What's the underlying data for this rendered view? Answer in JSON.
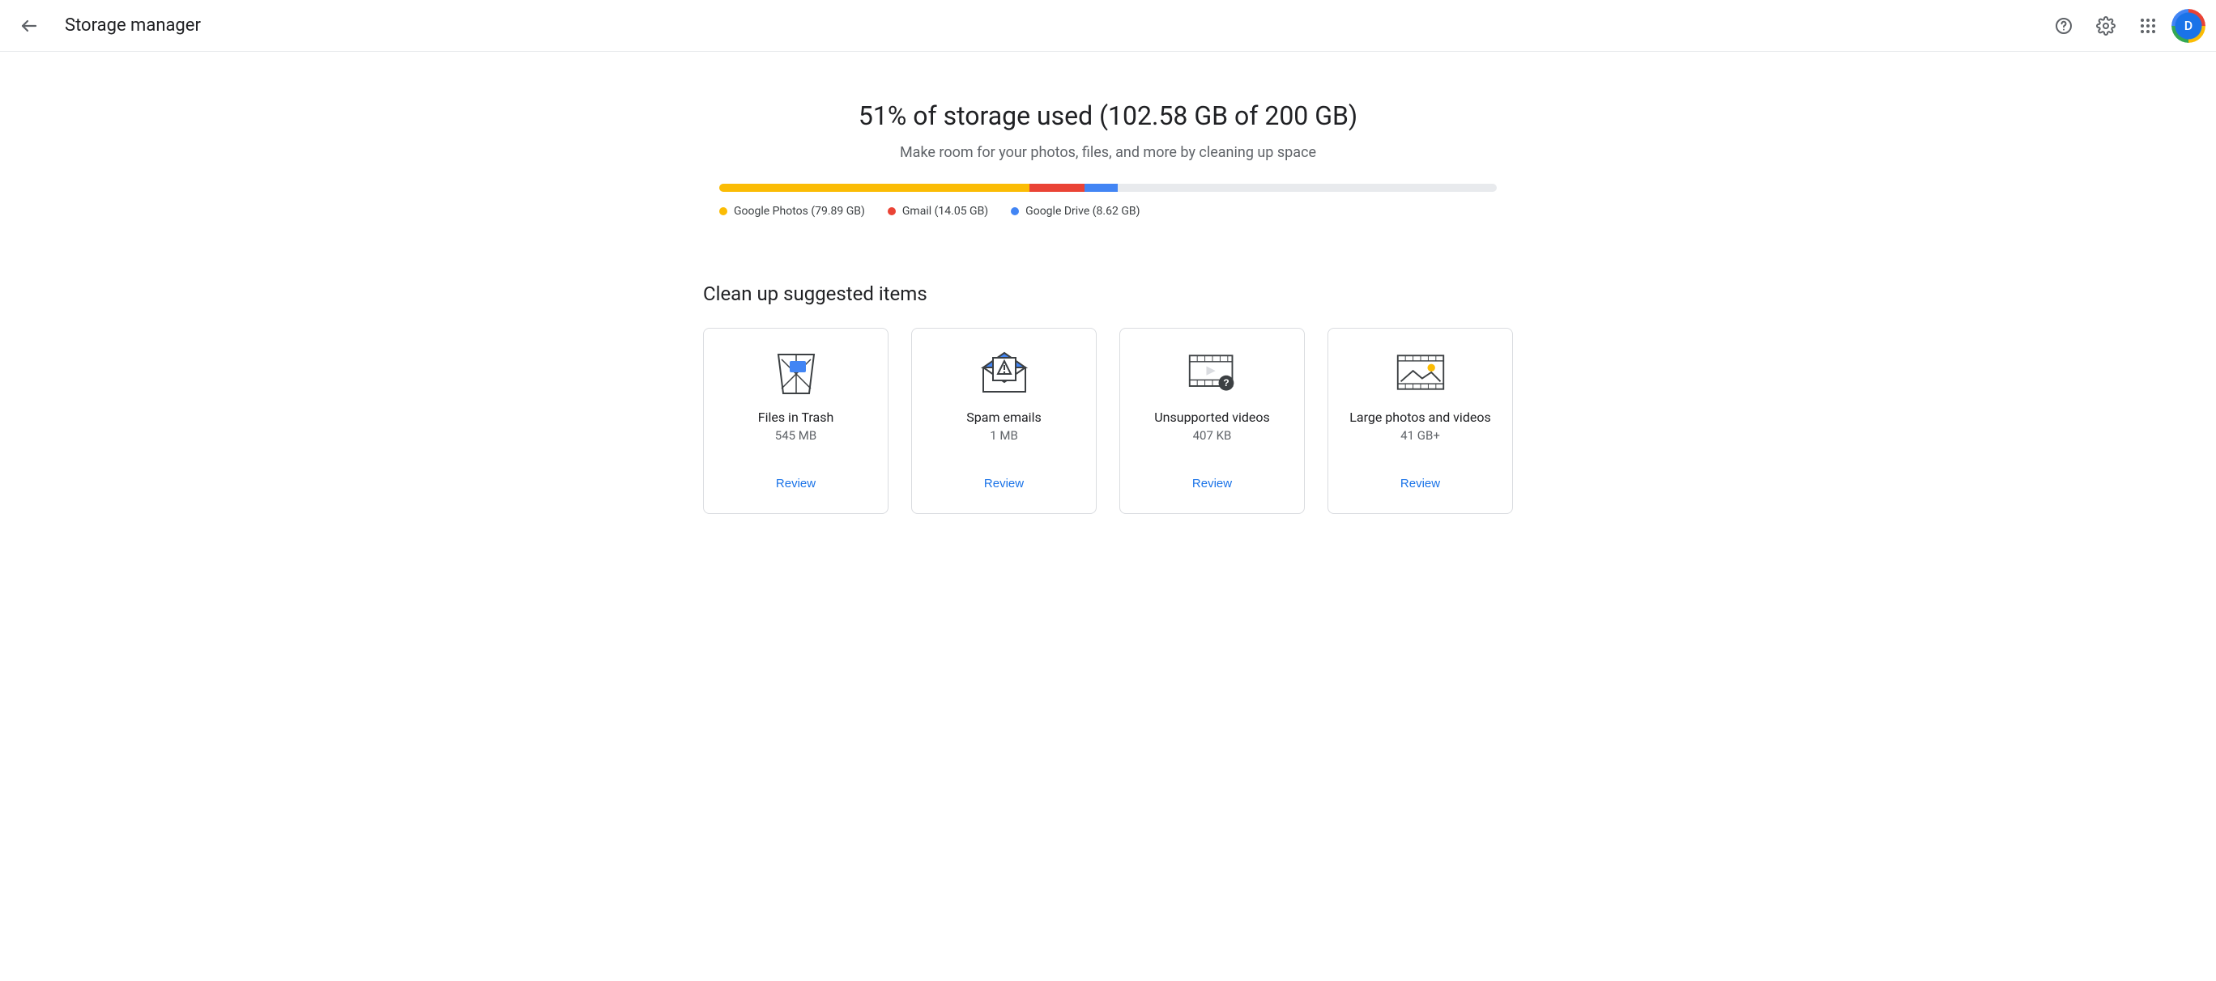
{
  "header": {
    "title": "Storage manager",
    "avatar_initial": "D"
  },
  "storage": {
    "heading": "51% of storage used (102.58 GB of 200 GB)",
    "subheading": "Make room for your photos, files, and more by cleaning up space",
    "total_gb": 200,
    "segments": [
      {
        "key": "photos",
        "label": "Google Photos (79.89 GB)",
        "gb": 79.89,
        "color": "#fbbc04"
      },
      {
        "key": "gmail",
        "label": "Gmail (14.05 GB)",
        "gb": 14.05,
        "color": "#ea4335"
      },
      {
        "key": "drive",
        "label": "Google Drive (8.62 GB)",
        "gb": 8.62,
        "color": "#4285f4"
      }
    ]
  },
  "cleanup": {
    "section_title": "Clean up suggested items",
    "review_label": "Review",
    "cards": [
      {
        "key": "trash",
        "title": "Files in Trash",
        "size": "545 MB"
      },
      {
        "key": "spam",
        "title": "Spam emails",
        "size": "1 MB"
      },
      {
        "key": "unsupported",
        "title": "Unsupported videos",
        "size": "407 KB"
      },
      {
        "key": "large",
        "title": "Large photos and videos",
        "size": "41 GB+"
      }
    ]
  }
}
